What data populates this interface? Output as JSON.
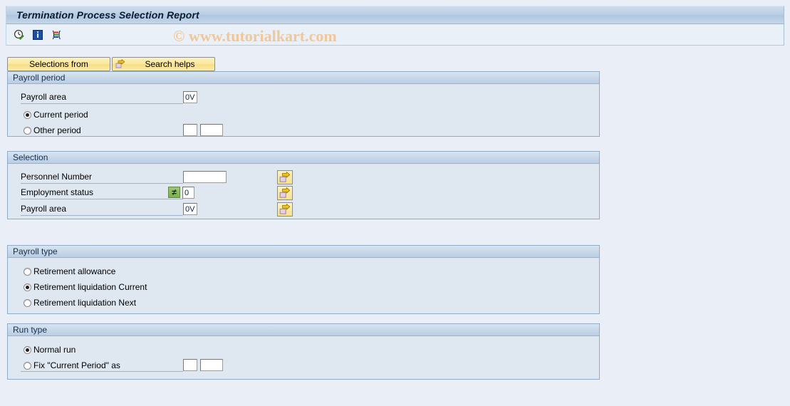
{
  "window": {
    "title": "Termination Process Selection Report"
  },
  "watermark": {
    "text": "© www.tutorialkart.com",
    "color": "#f0c79a"
  },
  "toolbar": {
    "icons": [
      {
        "name": "execute-icon",
        "title": "Execute"
      },
      {
        "name": "info-icon",
        "title": "Information"
      },
      {
        "name": "variant-icon",
        "title": "Get Variant"
      }
    ]
  },
  "actions": {
    "selections_from_label": "Selections from",
    "search_helps_label": "Search helps"
  },
  "panels": {
    "payroll_period": {
      "title": "Payroll period",
      "payroll_area_label": "Payroll area",
      "payroll_area_value": "0V",
      "current_period_label": "Current period",
      "current_period_selected": true,
      "other_period_label": "Other period",
      "other_period_selected": false,
      "other_period_value_1": "",
      "other_period_value_2": ""
    },
    "selection": {
      "title": "Selection",
      "rows": [
        {
          "label": "Personnel Number",
          "value": "",
          "operator": "",
          "has_operator": false,
          "multi_select": "multi-select-arrow-icon"
        },
        {
          "label": "Employment status",
          "value": "0",
          "operator": "≠",
          "has_operator": true,
          "multi_select": "multi-select-arrow-icon"
        },
        {
          "label": "Payroll area",
          "value": "0V",
          "operator": "",
          "has_operator": false,
          "multi_select": "multi-select-arrow-icon"
        }
      ]
    },
    "payroll_type": {
      "title": "Payroll type",
      "options": [
        {
          "label": "Retirement allowance",
          "selected": false
        },
        {
          "label": "Retirement liquidation Current",
          "selected": true
        },
        {
          "label": "Retirement liquidation Next",
          "selected": false
        }
      ]
    },
    "run_type": {
      "title": "Run type",
      "options": [
        {
          "label": "Normal run",
          "selected": true
        },
        {
          "label": "Fix \"Current Period\" as",
          "selected": false
        }
      ],
      "fix_value_1": "",
      "fix_value_2": ""
    }
  },
  "colors": {
    "page_background": "#e9eef7",
    "panel_background": "#dfe8f1",
    "panel_border": "#8fadc9",
    "title_bar": "#b9cee4",
    "button_yellow": "#fbe79b",
    "operator_green": "#7db04f"
  }
}
